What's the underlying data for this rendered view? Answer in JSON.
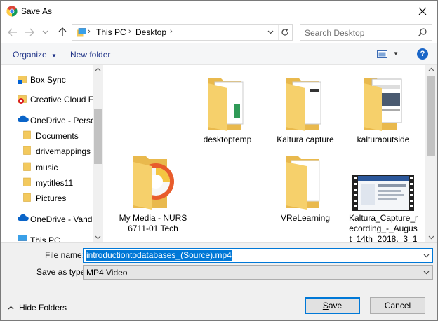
{
  "window": {
    "title": "Save As",
    "app_icon": "chrome-icon"
  },
  "address": {
    "crumbs": [
      "This PC",
      "Desktop"
    ],
    "search_placeholder": "Search Desktop"
  },
  "toolbar": {
    "organize_label": "Organize",
    "new_folder_label": "New folder",
    "help_label": "?"
  },
  "nav": {
    "items": [
      {
        "label": "Box Sync",
        "icon": "box-sync-icon"
      },
      {
        "label": "Creative Cloud File",
        "icon": "creative-cloud-icon"
      },
      {
        "label": "OneDrive - Person",
        "icon": "onedrive-icon"
      },
      {
        "label": "Documents",
        "icon": "folder-icon"
      },
      {
        "label": "drivemappings",
        "icon": "folder-icon"
      },
      {
        "label": "music",
        "icon": "folder-icon"
      },
      {
        "label": "mytitles11",
        "icon": "folder-icon"
      },
      {
        "label": "Pictures",
        "icon": "folder-icon"
      },
      {
        "label": "OneDrive - Vande",
        "icon": "onedrive-icon"
      },
      {
        "label": "This PC",
        "icon": "computer-icon"
      }
    ]
  },
  "files": [
    {
      "name": "",
      "kind": "blank"
    },
    {
      "name": "desktoptemp",
      "kind": "folder-docs"
    },
    {
      "name": "Kaltura capture",
      "kind": "folder-docs"
    },
    {
      "name": "kalturaoutside",
      "kind": "folder-browser"
    },
    {
      "name": "My Media - NURS 6711-01 Tech",
      "kind": "folder-media"
    },
    {
      "name": "",
      "kind": "blank"
    },
    {
      "name": "VReLearning",
      "kind": "folder-plain"
    },
    {
      "name": "Kaltura_Capture_recording_-_August_14th_2018,_3_1",
      "kind": "video"
    }
  ],
  "form": {
    "file_name_label": "File name:",
    "file_name_value": "introductiontodatabases_(Source).mp4",
    "save_type_label": "Save as type:",
    "save_type_value": "MP4 Video",
    "hide_folders_label": "Hide Folders",
    "save_label": "Save",
    "cancel_label": "Cancel"
  },
  "colors": {
    "accent": "#0078d7",
    "folder": "#f3c95d",
    "link": "#1e3287"
  }
}
